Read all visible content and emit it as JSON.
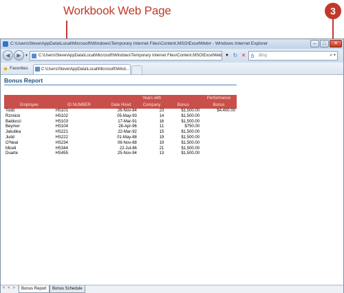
{
  "callout": {
    "label": "Workbook Web Page",
    "step_number": "3"
  },
  "window": {
    "title": "C:\\Users\\Steve\\AppData\\Local\\Microsoft\\Windows\\Temporary Internet Files\\Content.MSO\\ExcelWeb# - Windows Internet Explorer",
    "controls": {
      "minimize": "–",
      "maximize": "□",
      "close": "✕"
    }
  },
  "navbar": {
    "back": "◀",
    "forward": "▶",
    "address": "C:\\Users\\Steve\\AppData\\Local\\Microsoft\\Windows\\Temporary Internet Files\\Content.MSO\\ExcelWeb",
    "refresh": "↻",
    "stop": "✕",
    "search_placeholder": "Bing"
  },
  "favbar": {
    "favorites_label": "Favorites",
    "tab_label": "C:\\Users\\Steve\\AppData\\Local\\Microsoft\\Wind..."
  },
  "report": {
    "title": "Bonus Report",
    "header_top": {
      "years": "Years with",
      "performance": "Performance"
    },
    "columns": [
      "Employee",
      "ID NUMBER",
      "Date Hired",
      "Company",
      "Bonus",
      "Bonus"
    ],
    "rows": [
      {
        "employee": "Todd",
        "id": "HS101",
        "date": "26-Nov-84",
        "years": "23",
        "bonus": "$1,500.00",
        "perf": "$4,400.00"
      },
      {
        "employee": "Rznnick",
        "id": "HS102",
        "date": "05-May-93",
        "years": "14",
        "bonus": "$1,500.00",
        "perf": ""
      },
      {
        "employee": "Balducci",
        "id": "HS103",
        "date": "17-Mar-91",
        "years": "16",
        "bonus": "$1,500.00",
        "perf": ""
      },
      {
        "employee": "Beymer",
        "id": "HS104",
        "date": "28-Apr-96",
        "years": "11",
        "bonus": "$750.00",
        "perf": ""
      },
      {
        "employee": "Jakubka",
        "id": "HS221",
        "date": "22-Mar-92",
        "years": "15",
        "bonus": "$1,500.00",
        "perf": ""
      },
      {
        "employee": "Judd",
        "id": "HS222",
        "date": "01-May-88",
        "years": "19",
        "bonus": "$1,500.00",
        "perf": ""
      },
      {
        "employee": "O'Neal",
        "id": "HS234",
        "date": "06-Nov-88",
        "years": "19",
        "bonus": "$1,500.00",
        "perf": ""
      },
      {
        "employee": "Miceli",
        "id": "HS344",
        "date": "22-Jul-86",
        "years": "21",
        "bonus": "$1,500.00",
        "perf": ""
      },
      {
        "employee": "Duarte",
        "id": "HS455",
        "date": "25-Nov-94",
        "years": "13",
        "bonus": "$1,500.00",
        "perf": ""
      }
    ]
  },
  "sheets": {
    "nav": "< < > >",
    "tabs": [
      "Bonus Report",
      "Bonus Schedule"
    ]
  }
}
